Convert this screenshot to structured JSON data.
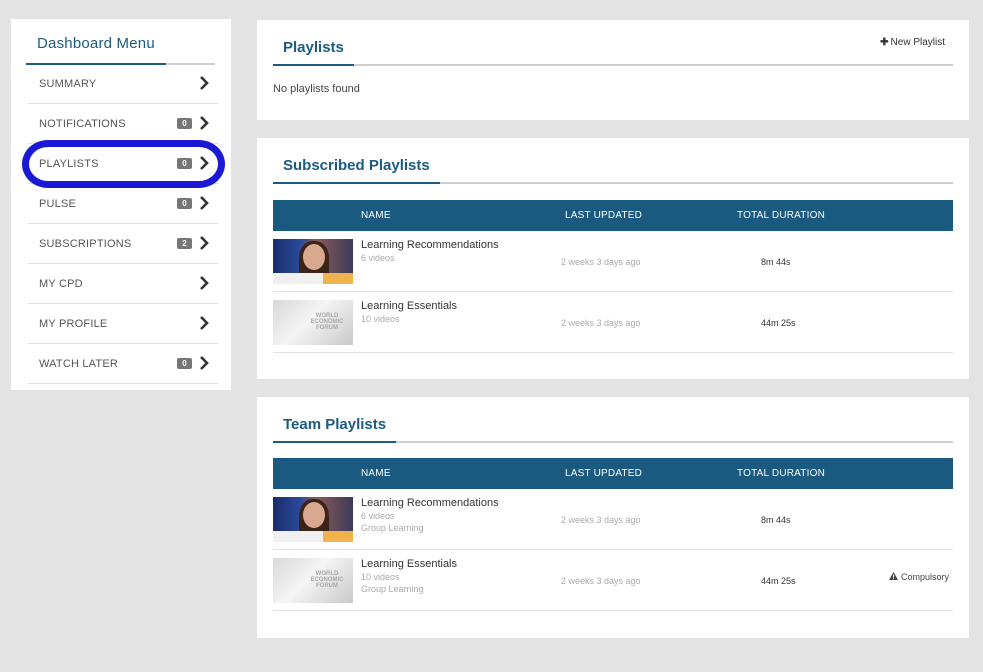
{
  "sidebar": {
    "title": "Dashboard Menu",
    "items": [
      {
        "label": "SUMMARY",
        "badge": null
      },
      {
        "label": "NOTIFICATIONS",
        "badge": "0"
      },
      {
        "label": "PLAYLISTS",
        "badge": "0"
      },
      {
        "label": "PULSE",
        "badge": "0"
      },
      {
        "label": "SUBSCRIPTIONS",
        "badge": "2"
      },
      {
        "label": "MY CPD",
        "badge": null
      },
      {
        "label": "MY PROFILE",
        "badge": null
      },
      {
        "label": "WATCH LATER",
        "badge": "0"
      }
    ]
  },
  "playlists": {
    "title": "Playlists",
    "new_label": "New Playlist",
    "empty": "No playlists found"
  },
  "subscribed": {
    "title": "Subscribed Playlists",
    "columns": [
      "NAME",
      "LAST UPDATED",
      "TOTAL DURATION"
    ],
    "rows": [
      {
        "name": "Learning Recommendations",
        "videos": "6 videos",
        "updated": "2 weeks 3 days ago",
        "duration": "8m 44s"
      },
      {
        "name": "Learning Essentials",
        "videos": "10 videos",
        "updated": "2 weeks 3 days ago",
        "duration": "44m 25s"
      }
    ]
  },
  "team": {
    "title": "Team Playlists",
    "columns": [
      "NAME",
      "LAST UPDATED",
      "TOTAL DURATION"
    ],
    "rows": [
      {
        "name": "Learning Recommendations",
        "videos": "6 videos",
        "group": "Group Learning",
        "updated": "2 weeks 3 days ago",
        "duration": "8m 44s",
        "flag": ""
      },
      {
        "name": "Learning Essentials",
        "videos": "10 videos",
        "group": "Group Learning",
        "updated": "2 weeks 3 days ago",
        "duration": "44m 25s",
        "flag": "Compulsory"
      }
    ]
  },
  "thumb_text": "WORLD ECONOMIC FORUM",
  "colors": {
    "accent": "#1c5b82",
    "header": "#1b5a80",
    "highlight": "#1a1ad6"
  }
}
